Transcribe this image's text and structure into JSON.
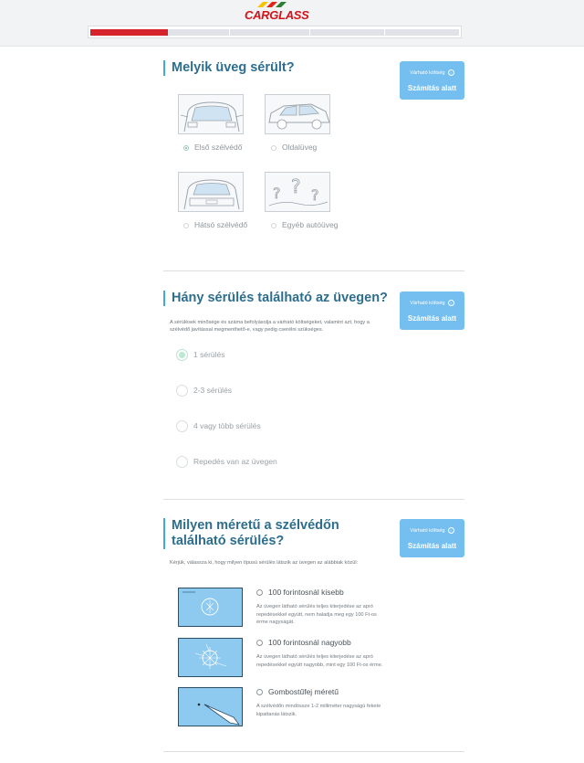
{
  "brand": {
    "logo": "CARGLASS",
    "stripe_colors": [
      "#f5c400",
      "#e1261c",
      "#2e7d32"
    ]
  },
  "progress": {
    "value": 0.21,
    "fill_color": "#d4232a"
  },
  "estimate": {
    "small_label": "Várható költség",
    "big_label": "Számítás alatt",
    "bg_color": "#74bff0"
  },
  "sections": {
    "glass": {
      "title": "Melyik üveg sérült?",
      "options": [
        {
          "label": "Első szélvédő",
          "selected": true,
          "icon": "windshield-front-icon"
        },
        {
          "label": "Oldalüveg",
          "selected": false,
          "icon": "side-window-icon"
        },
        {
          "label": "Hátsó szélvédő",
          "selected": false,
          "icon": "windshield-rear-icon"
        },
        {
          "label": "Egyéb autóüveg",
          "selected": false,
          "icon": "question-marks-icon"
        }
      ]
    },
    "damage_count": {
      "title": "Hány sérülés található az üvegen?",
      "description": "A sérülések minősége és száma befolyásolja a várható költségeket, valamint azt, hogy a szélvédő javítással megmenthető-e, vagy pedig cserélni szükséges.",
      "options": [
        {
          "label": "1 sérülés",
          "selected": true
        },
        {
          "label": "2-3 sérülés",
          "selected": false
        },
        {
          "label": "4 vagy több sérülés",
          "selected": false
        },
        {
          "label": "Repedés van az üvegen",
          "selected": false
        }
      ]
    },
    "damage_size": {
      "title": "Milyen méretű a szélvédőn található sérülés?",
      "description": "Kérjük, válassza ki, hogy milyen típusú sérülés látszik az üvegen az alábbiak közül:",
      "options": [
        {
          "label": "100 forintosnál kisebb",
          "description": "Az üvegen látható sérülés teljes kiterjedése az apró repedésekkel együtt, nem haladja meg egy 100 Ft-os érme nagyságát.",
          "icon": "small-chip-icon"
        },
        {
          "label": "100 forintosnál nagyobb",
          "description": "Az üvegen látható sérülés teljes kiterjedése az apró repedésekkel együtt nagyobb, mint egy 100 Ft-os érme.",
          "icon": "large-chip-icon"
        },
        {
          "label": "Gombostűfej méretű",
          "description": "A szélvédőn mindössze 1-2 milliméter nagyságú fekete kipattanás látszik.",
          "icon": "pinhead-pen-icon"
        }
      ]
    }
  }
}
